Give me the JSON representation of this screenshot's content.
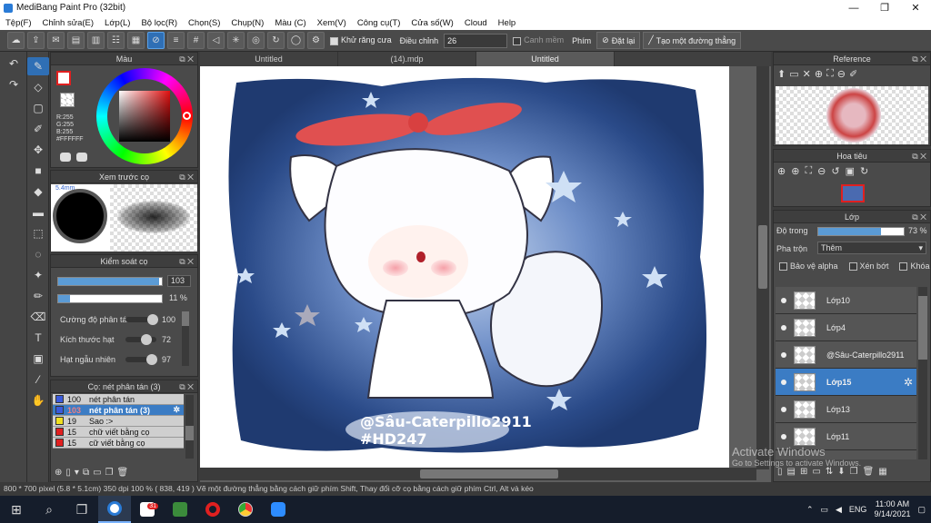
{
  "window": {
    "title": "MediBang Paint Pro (32bit)",
    "minimize": "—",
    "maximize": "❐",
    "close": "✕"
  },
  "menu": [
    "Tệp(F)",
    "Chỉnh sửa(E)",
    "Lớp(L)",
    "Bộ lọc(R)",
    "Chọn(S)",
    "Chụp(N)",
    "Màu (C)",
    "Xem(V)",
    "Công cụ(T)",
    "Cửa số(W)",
    "Cloud",
    "Help"
  ],
  "toolbar": {
    "antialias_label": "Khử răng cưa",
    "adjust_label": "Điều chỉnh",
    "adjust_value": "26",
    "smooth_label": "Canh mềm",
    "key_label": "Phím",
    "reset_label": "Đặt lại",
    "create_line_label": "Tạo một đường thẳng"
  },
  "color_panel": {
    "title": "Màu",
    "r": "R:255",
    "g": "G:255",
    "b": "B:255",
    "hex": "#FFFFFF",
    "hue_color": "#e01010"
  },
  "brush_preview_panel": {
    "title": "Xem trước cọ",
    "size": "5.4mm"
  },
  "brush_control_panel": {
    "title": "Kiểm soát cọ",
    "size_value": "103",
    "size_fill": 0.97,
    "opacity_value": "11 %",
    "opacity_fill": 0.11,
    "params": [
      {
        "label": "Cường độ phân tán",
        "value": "100",
        "level": 1.0
      },
      {
        "label": "Kích thước hạt",
        "value": "72",
        "level": 0.72
      },
      {
        "label": "Hạt ngẫu nhiên",
        "value": "97",
        "level": 0.97
      }
    ]
  },
  "brush_list_panel": {
    "title": "Cọ: nét phân tán (3)",
    "items": [
      {
        "num": "100",
        "name": "nét phân tán",
        "color": "#3b5bdb"
      },
      {
        "num": "103",
        "name": "nét phân tán (3)",
        "color": "#3b5bdb",
        "selected": true
      },
      {
        "num": "19",
        "name": "Sao :>",
        "color": "#f0e020"
      },
      {
        "num": "15",
        "name": "chữ viết bằng cọ",
        "color": "#e02020"
      },
      {
        "num": "15",
        "name": "cữ viết bằng cọ",
        "color": "#e02020"
      }
    ]
  },
  "tabs": [
    "Untitled",
    "(14).mdp",
    "Untitled"
  ],
  "canvas": {
    "watermark_line1": "@Sâu-Caterpillo2911",
    "watermark_line2": "#HD247"
  },
  "reference_panel": {
    "title": "Reference"
  },
  "navigator_panel": {
    "title": "Hoa tiêu"
  },
  "layer_panel": {
    "title": "Lớp",
    "opacity_label": "Độ trong",
    "opacity_value": "73 %",
    "opacity_fill": 0.73,
    "blend_label": "Pha trộn",
    "blend_value": "Thêm",
    "protect_alpha_label": "Bảo vệ alpha",
    "clip_label": "Xén bớt",
    "lock_label": "Khóa",
    "layers": [
      {
        "name": "Lớp10"
      },
      {
        "name": "Lớp4"
      },
      {
        "name": "@Sâu-Caterpillo2911"
      },
      {
        "name": "Lớp15",
        "selected": true
      },
      {
        "name": "Lớp13"
      },
      {
        "name": "Lớp11"
      }
    ]
  },
  "status": {
    "text": "800 * 700 pixel   (5.8 * 5.1cm)   350 dpi   100 %   ( 838, 419 )   Vẽ một đường thẳng bằng cách giữ phím Shift, Thay đổi cỡ cọ bằng cách giữ phím Ctrl, Alt và kéo"
  },
  "activate": {
    "line1": "Activate Windows",
    "line2": "Go to Settings to activate Windows."
  },
  "taskbar": {
    "lang": "ENG",
    "time": "11:00 AM",
    "date": "9/14/2021",
    "notif": "31"
  }
}
